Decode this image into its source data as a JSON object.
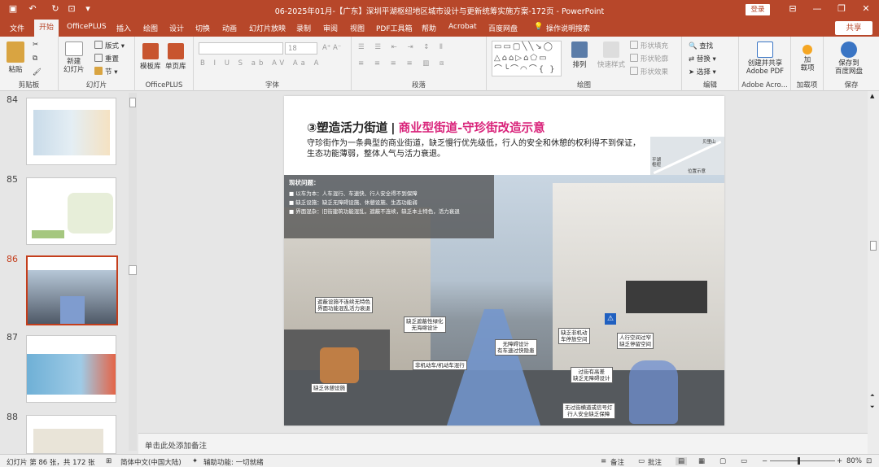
{
  "app": {
    "title": "06-2025年01月-【广东】深圳平湖枢纽地区城市设计与更新统筹实施方案-172页  -  PowerPoint",
    "login": "登录",
    "accent": "#b7472a"
  },
  "tabs": [
    "文件",
    "开始",
    "OfficePLUS",
    "插入",
    "绘图",
    "设计",
    "切换",
    "动画",
    "幻灯片放映",
    "录制",
    "审阅",
    "视图",
    "PDF工具箱",
    "帮助",
    "Acrobat",
    "百度网盘",
    "操作说明搜索"
  ],
  "share": "共享",
  "ribbon": {
    "clipboard": {
      "label": "剪贴板",
      "paste": "粘贴"
    },
    "slides": {
      "label": "幻灯片",
      "new_slide": "新建\n幻灯片",
      "layout": "版式",
      "reset": "重置",
      "section": "节"
    },
    "officeplus": {
      "label": "OfficePLUS",
      "template": "模板库",
      "single": "单页库"
    },
    "font": {
      "label": "字体",
      "size": "18"
    },
    "paragraph": {
      "label": "段落"
    },
    "drawing": {
      "label": "绘图",
      "arrange": "排列",
      "quick_styles": "快速样式",
      "fill": "形状填充",
      "outline": "形状轮廓",
      "effects": "形状效果"
    },
    "editing": {
      "label": "编辑",
      "find": "查找",
      "replace": "替换",
      "select": "选择"
    },
    "adobe": {
      "label": "Adobe Acro...",
      "create": "创建并共享\nAdobe PDF"
    },
    "addins": {
      "label": "加载项",
      "item": "加\n载项"
    },
    "save": {
      "label": "保存",
      "item": "保存到\n百度网盘"
    }
  },
  "thumbnails": [
    {
      "num": "84"
    },
    {
      "num": "85"
    },
    {
      "num": "86"
    },
    {
      "num": "87"
    },
    {
      "num": "88"
    }
  ],
  "slide": {
    "title_num": "③塑造活力街道",
    "title_sub": "商业型街道-守珍街改造示意",
    "body": "守珍街作为一条典型的商业街道，缺乏慢行优先级低，行人的安全和休憩的权利得不到保证，生态功能薄弱，整体人气与活力衰退。",
    "map_labels": [
      "贝里山",
      "平湖\n枢纽",
      "位置示意"
    ],
    "issues_title": "现状问题：",
    "issues": [
      "以车为本：人车混行、车速快、行人安全得不到保障",
      "缺乏设施：缺乏无障碍设施、休憩设施、生态功能弱",
      "界面混杂：旧街建筑功能混乱，遮蔽不连续，缺乏本土特色，活力衰退"
    ],
    "callouts": [
      "遮蔽设施不连续无特色\n界面功能混乱活力衰退",
      "缺乏遮蔽性绿化\n无海绵设计",
      "无障碍设计\n有车速过快隐患",
      "缺乏非机动\n车停放空间",
      "人行空间过窄\n缺乏停留空间",
      "非机动车/机动车混行",
      "过街有高差\n缺乏无障碍设计",
      "缺乏休憩设施",
      "无过街横道或信号灯\n行人安全缺乏保障"
    ]
  },
  "notes": "单击此处添加备注",
  "status": {
    "slide": "幻灯片 第 86 张，共 172 张",
    "lang": "简体中文(中国大陆)",
    "access": "辅助功能: 一切就绪",
    "notes": "备注",
    "comments": "批注",
    "zoom": "80%"
  }
}
